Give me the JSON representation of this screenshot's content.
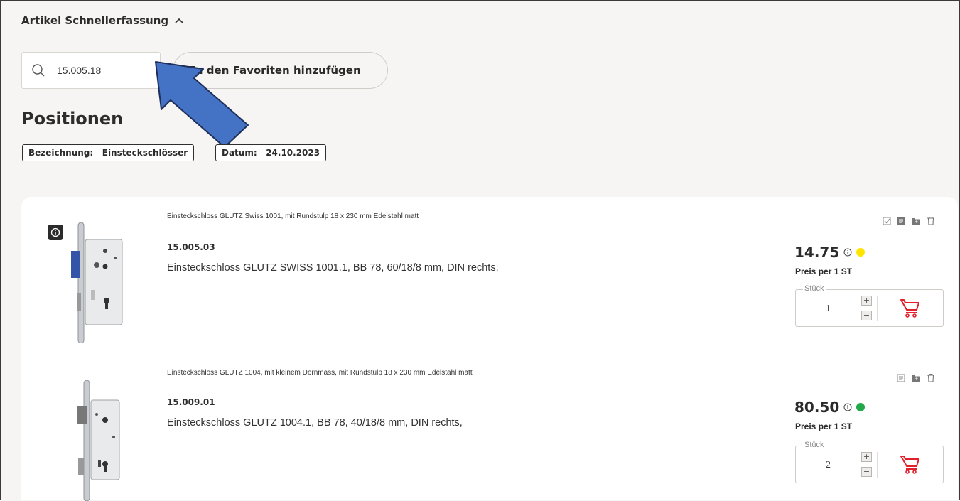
{
  "section": {
    "title": "Artikel Schnellerfassung"
  },
  "search": {
    "value": "15.005.18"
  },
  "favorites_button": {
    "label": "Zu den Favoriten hinzufügen"
  },
  "positions": {
    "heading": "Positionen"
  },
  "filters": [
    {
      "label": "Bezeichnung:",
      "value": "Einsteckschlösser"
    },
    {
      "label": "Datum:",
      "value": "24.10.2023"
    }
  ],
  "colors": {
    "accent_red": "#e1202b",
    "status_yellow": "#ffe400",
    "status_green": "#22a84b",
    "arrow_blue": "#4472c4"
  },
  "items": [
    {
      "short_text": "Einsteckschloss GLUTZ Swiss 1001, mit Rundstulp 18 x 230 mm Edelstahl matt",
      "article_no": "15.005.03",
      "description": "Einsteckschloss GLUTZ SWISS 1001.1, BB 78, 60/18/8 mm, DIN rechts,",
      "price": "14.75",
      "price_unit": "Preis per 1 ST",
      "qty_label": "Stück",
      "qty": "1",
      "status": "yellow",
      "actions": [
        "checklist-icon",
        "note-icon",
        "move-to-folder-icon",
        "trash-icon"
      ]
    },
    {
      "short_text": "Einsteckschloss GLUTZ 1004, mit kleinem Dornmass, mit Rundstulp 18 x 230 mm Edelstahl matt",
      "article_no": "15.009.01",
      "description": "Einsteckschloss GLUTZ 1004.1, BB 78, 40/18/8 mm, DIN rechts,",
      "price": "80.50",
      "price_unit": "Preis per 1 ST",
      "qty_label": "Stück",
      "qty": "2",
      "status": "green",
      "actions": [
        "note-icon",
        "move-to-folder-icon",
        "trash-icon"
      ]
    }
  ]
}
